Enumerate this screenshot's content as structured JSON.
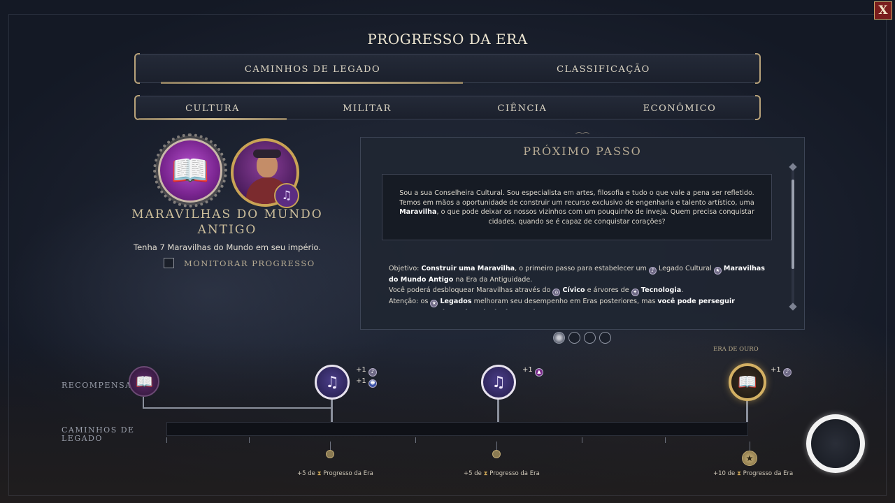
{
  "window": {
    "title": "PROGRESSO DA ERA",
    "close_label": "X"
  },
  "main_tabs": [
    {
      "label": "CAMINHOS DE LEGADO",
      "active": true
    },
    {
      "label": "CLASSIFICAÇÃO",
      "active": false
    }
  ],
  "sub_tabs": [
    {
      "label": "CULTURA",
      "active": true
    },
    {
      "label": "MILITAR",
      "active": false
    },
    {
      "label": "CIÊNCIA",
      "active": false
    },
    {
      "label": "ECONÔMICO",
      "active": false
    }
  ],
  "legacy": {
    "title": "MARAVILHAS DO MUNDO ANTIGO",
    "description": "Tenha 7 Maravilhas do Mundo em seu império.",
    "monitor_label": "MONITORAR PROGRESSO",
    "monitor_checked": false,
    "medal_icon": "book-icon",
    "advisor_badge_icon": "music-note-icon"
  },
  "next_step": {
    "title": "PRÓXIMO PASSO",
    "quote_parts": [
      "Sou a sua Conselheira Cultural. Sou especialista em artes, filosofia e tudo o que vale a pena ser refletido. Temos em mãos a oportunidade de construir um recurso exclusivo de engenharia e talento artístico, uma ",
      "Maravilha",
      ", o que pode deixar os nossos vizinhos com um pouquinho de inveja. Quem precisa conquistar cidades, quando se é capaz de conquistar corações?"
    ],
    "objective": {
      "p1": "Objetivo: ",
      "b1": "Construir uma Maravilha",
      "p2": ", o primeiro passo para estabelecer um ",
      "p3": " Legado Cultural ",
      "b2": "Maravilhas do Mundo Antigo",
      "p4": " na Era da Antiguidade."
    },
    "unlock": {
      "p1": "Você poderá desbloquear Maravilhas através do ",
      "b1": "Cívico",
      "p2": " e árvores de ",
      "b2": "Tecnologia",
      "p3": "."
    },
    "attention": {
      "p1": "Atenção: os ",
      "b1": "Legados",
      "p2": " melhoram seu desempenho em Eras posteriores, mas ",
      "b2": "você pode perseguir quantos Legados quiser, inclusive nenhum",
      "p3": "."
    },
    "pages_total": 4,
    "page_current": 1
  },
  "timeline": {
    "rewards_label": "RECOMPENSAS",
    "paths_label": "CAMINHOS DE LEGADO",
    "golden_age_label": "ERA DE OURO",
    "milestones": [
      {
        "plus": [
          "+1",
          "+1"
        ],
        "progress_amount": "+5 de",
        "progress_label": "Progresso da Era"
      },
      {
        "plus": [
          "+1"
        ],
        "progress_amount": "+5 de",
        "progress_label": "Progresso da Era"
      },
      {
        "plus": [
          "+1"
        ],
        "progress_amount": "+10 de",
        "progress_label": "Progresso da Era"
      }
    ],
    "progress_fraction": 0
  }
}
